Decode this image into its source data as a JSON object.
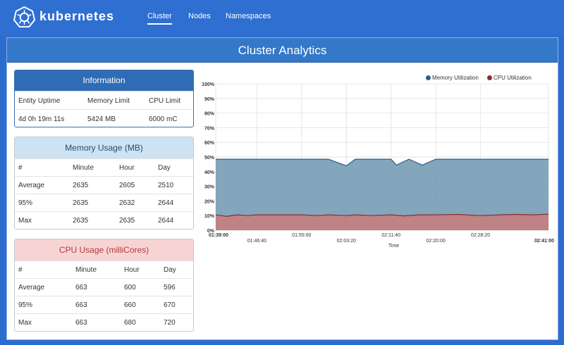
{
  "header": {
    "brand": "kubernetes",
    "nav": [
      "Cluster",
      "Nodes",
      "Namespaces"
    ],
    "active_nav": "Cluster"
  },
  "panel": {
    "title": "Cluster Analytics"
  },
  "info": {
    "title": "Information",
    "headers": [
      "Entity Uptime",
      "Memory Limit",
      "CPU Limit"
    ],
    "values": [
      "4d 0h 19m 11s",
      "5424 MB",
      "6000 mC"
    ]
  },
  "memory": {
    "title": "Memory Usage (MB)",
    "headers": [
      "#",
      "Minute",
      "Hour",
      "Day"
    ],
    "rows": [
      [
        "Average",
        "2635",
        "2605",
        "2510"
      ],
      [
        "95%",
        "2635",
        "2632",
        "2644"
      ],
      [
        "Max",
        "2635",
        "2635",
        "2644"
      ]
    ]
  },
  "cpu": {
    "title": "CPU Usage (milliCores)",
    "headers": [
      "#",
      "Minute",
      "Hour",
      "Day"
    ],
    "rows": [
      [
        "Average",
        "663",
        "600",
        "596"
      ],
      [
        "95%",
        "663",
        "660",
        "670"
      ],
      [
        "Max",
        "663",
        "680",
        "720"
      ]
    ]
  },
  "colors": {
    "memory": "#2c5f86",
    "memory_fill": "#6f97b0",
    "cpu": "#8c2e2e",
    "cpu_fill": "#c97b7b"
  },
  "chart_data": {
    "type": "area",
    "xlabel": "Time",
    "ylabel": "",
    "ylim": [
      0,
      100
    ],
    "y_ticks": [
      "0%",
      "10%",
      "20%",
      "30%",
      "40%",
      "50%",
      "60%",
      "70%",
      "80%",
      "90%",
      "100%"
    ],
    "x_ticks": [
      "01:39:00",
      "01:46:40",
      "01:55:00",
      "02:03:20",
      "02:11:40",
      "02:20:00",
      "02:28:20",
      "02:41:00"
    ],
    "legend": [
      "Memory Utilization",
      "CPU Utilization"
    ],
    "grid": true,
    "series": [
      {
        "name": "Memory Utilization",
        "x": [
          "01:39:00",
          "01:46:40",
          "01:55:00",
          "02:00:00",
          "02:03:20",
          "02:05:00",
          "02:11:40",
          "02:12:40",
          "02:15:00",
          "02:17:30",
          "02:20:00",
          "02:28:20",
          "02:35:00",
          "02:41:00"
        ],
        "values": [
          48.5,
          48.5,
          48.5,
          48.5,
          44,
          48.5,
          48.5,
          44.5,
          48.5,
          44.5,
          48.5,
          48.5,
          48.5,
          48.5
        ]
      },
      {
        "name": "CPU Utilization",
        "x": [
          "01:39:00",
          "01:41:00",
          "01:43:00",
          "01:45:00",
          "01:46:40",
          "01:50:00",
          "01:55:00",
          "01:58:00",
          "02:00:00",
          "02:03:20",
          "02:05:00",
          "02:08:00",
          "02:11:40",
          "02:14:00",
          "02:17:00",
          "02:20:00",
          "02:24:00",
          "02:28:20",
          "02:32:00",
          "02:35:00",
          "02:38:00",
          "02:41:00"
        ],
        "values": [
          10.5,
          9.5,
          10.5,
          10,
          10.5,
          10.5,
          10.5,
          10,
          10.5,
          10,
          10.5,
          10,
          10.5,
          9.8,
          10.5,
          10.5,
          10.8,
          10,
          10.5,
          10.8,
          10.5,
          11
        ]
      }
    ]
  }
}
